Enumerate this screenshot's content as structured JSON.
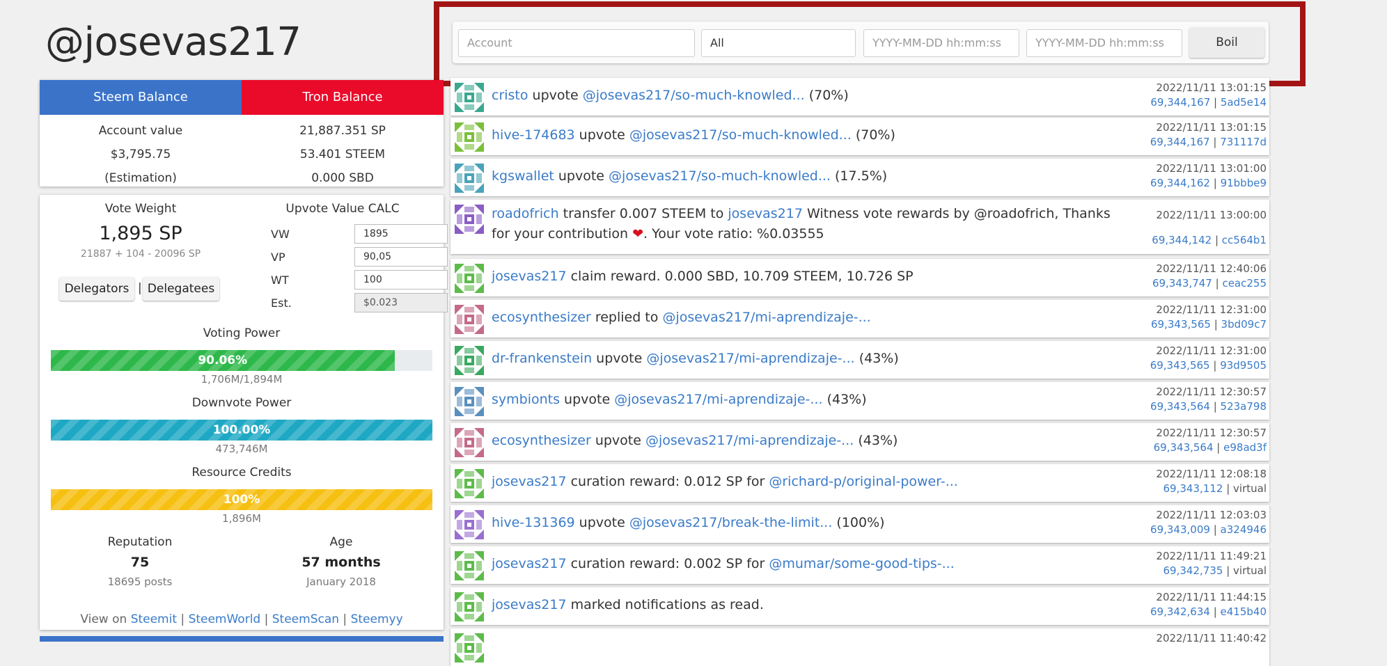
{
  "username": "@josevas217",
  "filter": {
    "account_placeholder": "Account",
    "type_selected": "All",
    "from_placeholder": "YYYY-MM-DD hh:mm:ss",
    "to_placeholder": "YYYY-MM-DD hh:mm:ss",
    "button": "Boil",
    "highlight_color": "#a31515"
  },
  "balance": {
    "tab_steem": "Steem Balance",
    "tab_tron": "Tron Balance",
    "steem_color": "#3b73c9",
    "tron_color": "#ea0a2a",
    "rows": [
      {
        "left": "Account value",
        "right": "21,887.351 SP"
      },
      {
        "left": "$3,795.75",
        "right": "53.401 STEEM"
      },
      {
        "left": "(Estimation)",
        "right": "0.000 SBD"
      }
    ]
  },
  "vote": {
    "weight_label": "Vote Weight",
    "weight_value": "1,895 SP",
    "weight_formula": "21887 + 104 - 20096 SP",
    "delegators": "Delegators",
    "separator": "|",
    "delegatees": "Delegatees",
    "calc_label": "Upvote Value CALC",
    "calc": [
      {
        "label": "VW",
        "value": "1895"
      },
      {
        "label": "VP",
        "value": "90,05"
      },
      {
        "label": "WT",
        "value": "100"
      },
      {
        "label": "Est.",
        "value": "$0.023"
      }
    ],
    "voting_power_label": "Voting Power",
    "voting_power_pct": 90.06,
    "voting_power_text": "90.06%",
    "voting_power_sub": "1,706M/1,894M",
    "voting_color": "#2eb84b",
    "downvote_label": "Downvote Power",
    "downvote_pct": 100,
    "downvote_text": "100.00%",
    "downvote_sub": "473,746M",
    "downvote_color": "#1ea8c4",
    "rc_label": "Resource Credits",
    "rc_pct": 100,
    "rc_text": "100%",
    "rc_sub": "1,896M",
    "rc_color": "#f6c012",
    "reputation_label": "Reputation",
    "reputation_value": "75",
    "reputation_sub": "18695 posts",
    "age_label": "Age",
    "age_value": "57 months",
    "age_sub": "January 2018",
    "view_on": "View on",
    "links": [
      "Steemit",
      "SteemWorld",
      "SteemScan",
      "Steemyy"
    ]
  },
  "feed": [
    {
      "user": "cristo",
      "action": " upvote ",
      "link": "@josevas217/so-much-knowled...",
      "tail": " (70%)",
      "date": "2022/11/11 13:01:15",
      "block": "69,344,167",
      "tx": "5ad5e14",
      "avatar_color": "#3aa88f"
    },
    {
      "user": "hive-174683",
      "action": " upvote ",
      "link": "@josevas217/so-much-knowled...",
      "tail": " (70%)",
      "date": "2022/11/11 13:01:15",
      "block": "69,344,167",
      "tx": "731117d",
      "avatar_color": "#7bbf3a"
    },
    {
      "user": "kgswallet",
      "action": " upvote ",
      "link": "@josevas217/so-much-knowled...",
      "tail": " (17.5%)",
      "date": "2022/11/11 13:01:00",
      "block": "69,344,162",
      "tx": "91bbbe9",
      "avatar_color": "#4aa3b8"
    },
    {
      "user": "roadofrich",
      "action": " transfer 0.007 STEEM to ",
      "link": "josevas217",
      "tail": " Witness vote rewards by @roadofrich, Thanks",
      "line2a": "for your contribution ",
      "line2b": ". Your vote ratio: %0.03555",
      "date": "2022/11/11 13:00:00",
      "block": "69,344,142",
      "tx": "cc564b1",
      "avatar_color": "#8a5cc4"
    },
    {
      "user": "josevas217",
      "action": " claim reward. 0.000 SBD, 10.709 STEEM, 10.726 SP",
      "link": "",
      "tail": "",
      "date": "2022/11/11 12:40:06",
      "block": "69,343,747",
      "tx": "ceac255",
      "avatar_color": "#5dbb4a"
    },
    {
      "user": "ecosynthesizer",
      "action": " replied to ",
      "link": "@josevas217/mi-aprendizaje-...",
      "tail": "",
      "date": "2022/11/11 12:31:00",
      "block": "69,343,565",
      "tx": "3bd09c7",
      "avatar_color": "#c46a8a"
    },
    {
      "user": "dr-frankenstein",
      "action": " upvote ",
      "link": "@josevas217/mi-aprendizaje-...",
      "tail": " (43%)",
      "date": "2022/11/11 12:31:00",
      "block": "69,343,565",
      "tx": "93d9505",
      "avatar_color": "#3aa860"
    },
    {
      "user": "symbionts",
      "action": " upvote ",
      "link": "@josevas217/mi-aprendizaje-...",
      "tail": " (43%)",
      "date": "2022/11/11 12:30:57",
      "block": "69,343,564",
      "tx": "523a798",
      "avatar_color": "#5a8fbf"
    },
    {
      "user": "ecosynthesizer",
      "action": " upvote ",
      "link": "@josevas217/mi-aprendizaje-...",
      "tail": " (43%)",
      "date": "2022/11/11 12:30:57",
      "block": "69,343,564",
      "tx": "e98ad3f",
      "avatar_color": "#c46a8a"
    },
    {
      "user": "josevas217",
      "action": " curation reward: 0.012 SP for ",
      "link": "@richard-p/original-power-...",
      "tail": "",
      "date": "2022/11/11 12:08:18",
      "block": "69,343,112",
      "tx": "virtual",
      "avatar_color": "#5dbb4a"
    },
    {
      "user": "hive-131369",
      "action": " upvote ",
      "link": "@josevas217/break-the-limit...",
      "tail": " (100%)",
      "date": "2022/11/11 12:03:03",
      "block": "69,343,009",
      "tx": "a324946",
      "avatar_color": "#9a6fd0"
    },
    {
      "user": "josevas217",
      "action": " curation reward: 0.002 SP for ",
      "link": "@mumar/some-good-tips-...",
      "tail": "",
      "date": "2022/11/11 11:49:21",
      "block": "69,342,735",
      "tx": "virtual",
      "avatar_color": "#5dbb4a"
    },
    {
      "user": "josevas217",
      "action": " marked notifications as read.",
      "link": "",
      "tail": "",
      "date": "2022/11/11 11:44:15",
      "block": "69,342,634",
      "tx": "e415b40",
      "avatar_color": "#5dbb4a"
    },
    {
      "user": "",
      "action": "",
      "link": "",
      "tail": "",
      "date": "2022/11/11 11:40:42",
      "block": "",
      "tx": "",
      "avatar_color": "#5dbb4a"
    }
  ]
}
